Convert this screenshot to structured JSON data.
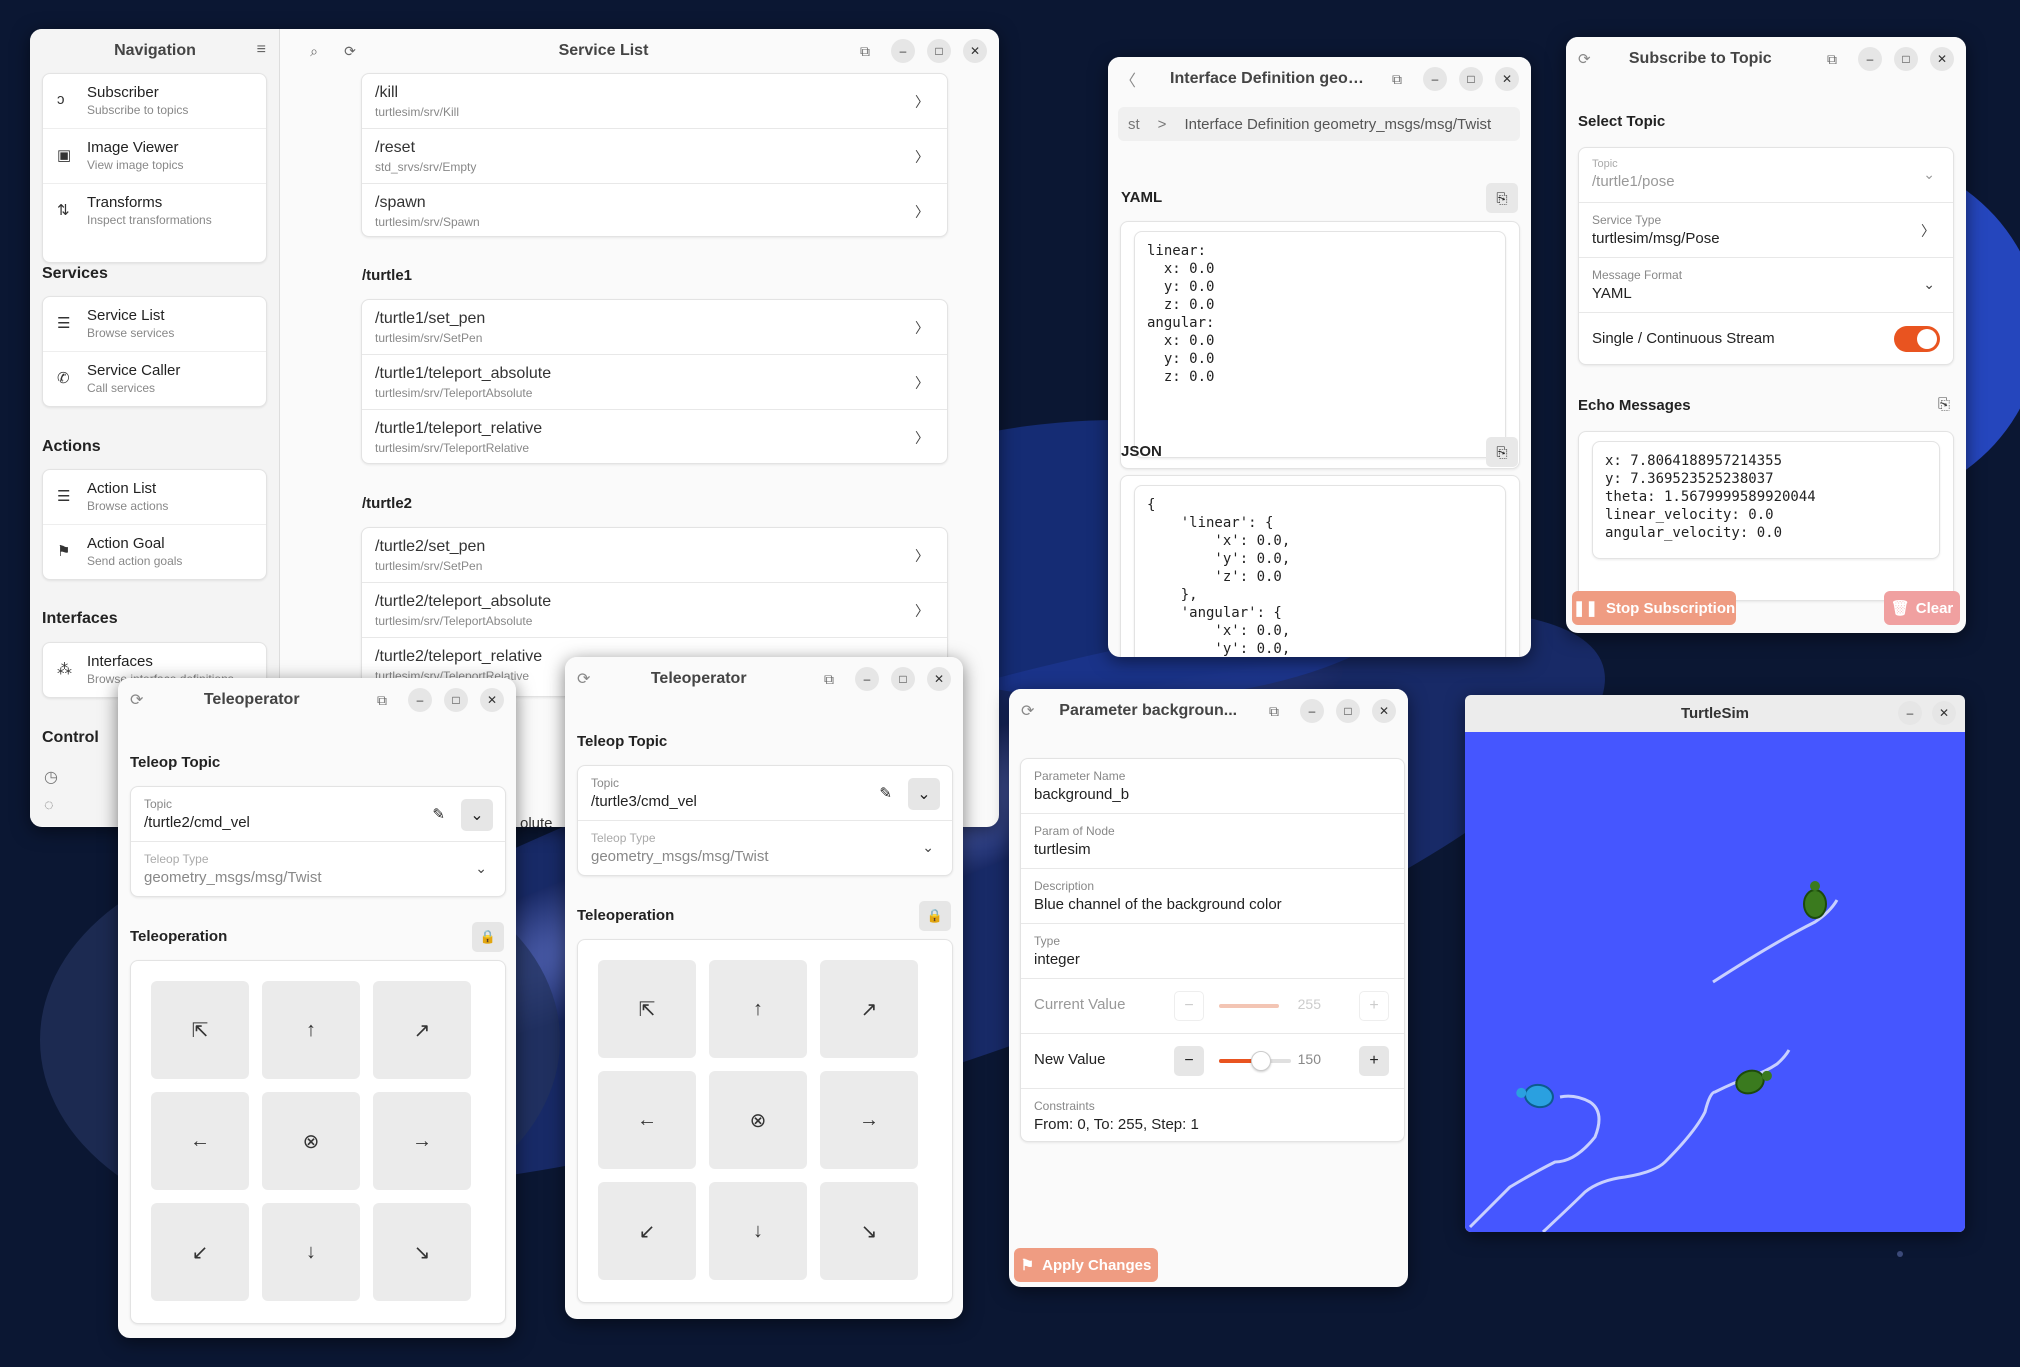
{
  "colors": {
    "accent": "#e95420",
    "desktop": "#0b1733",
    "turtle_bg": "#4556ff"
  },
  "nav": {
    "title": "Navigation",
    "group0": [
      {
        "name": "Subscriber",
        "desc": "Subscribe to topics",
        "icon": "ear-icon"
      },
      {
        "name": "Image Viewer",
        "desc": "View image topics",
        "icon": "image-icon"
      },
      {
        "name": "Transforms",
        "desc": "Inspect transformations",
        "icon": "transform-icon"
      }
    ],
    "services_heading": "Services",
    "services": [
      {
        "name": "Service List",
        "desc": "Browse services",
        "icon": "list-icon"
      },
      {
        "name": "Service Caller",
        "desc": "Call services",
        "icon": "phone-icon"
      }
    ],
    "actions_heading": "Actions",
    "actions": [
      {
        "name": "Action List",
        "desc": "Browse actions",
        "icon": "list-icon"
      },
      {
        "name": "Action Goal",
        "desc": "Send action goals",
        "icon": "flag-icon"
      }
    ],
    "interfaces_heading": "Interfaces",
    "interfaces": [
      {
        "name": "Interfaces",
        "desc": "Browse interface definitions",
        "icon": "shapes-icon"
      }
    ],
    "control_heading": "Control"
  },
  "service_list": {
    "title": "Service List",
    "group0": [
      {
        "name": "/kill",
        "type": "turtlesim/srv/Kill"
      },
      {
        "name": "/reset",
        "type": "std_srvs/srv/Empty"
      },
      {
        "name": "/spawn",
        "type": "turtlesim/srv/Spawn"
      }
    ],
    "turtle1_heading": "/turtle1",
    "turtle1": [
      {
        "name": "/turtle1/set_pen",
        "type": "turtlesim/srv/SetPen"
      },
      {
        "name": "/turtle1/teleport_absolute",
        "type": "turtlesim/srv/TeleportAbsolute"
      },
      {
        "name": "/turtle1/teleport_relative",
        "type": "turtlesim/srv/TeleportRelative"
      }
    ],
    "turtle2_heading": "/turtle2",
    "turtle2": [
      {
        "name": "/turtle2/set_pen",
        "type": "turtlesim/srv/SetPen"
      },
      {
        "name": "/turtle2/teleport_absolute",
        "type": "turtlesim/srv/TeleportAbsolute"
      },
      {
        "name": "/turtle2/teleport_relative",
        "type": "turtlesim/srv/TeleportRelative"
      }
    ],
    "partial_text": "olute"
  },
  "interface_def": {
    "title": "Interface Definition geom...",
    "crumb_prev": "st",
    "crumb_sep": ">",
    "crumb_current": "Interface Definition geometry_msgs/msg/Twist",
    "yaml_heading": "YAML",
    "yaml": "linear:\n  x: 0.0\n  y: 0.0\n  z: 0.0\nangular:\n  x: 0.0\n  y: 0.0\n  z: 0.0",
    "json_heading": "JSON",
    "json": "{\n    'linear': {\n        'x': 0.0,\n        'y': 0.0,\n        'z': 0.0\n    },\n    'angular': {\n        'x': 0.0,\n        'y': 0.0,"
  },
  "subscribe": {
    "title": "Subscribe to Topic",
    "select_heading": "Select Topic",
    "topic_label": "Topic",
    "topic_value": "/turtle1/pose",
    "service_type_label": "Service Type",
    "service_type_value": "turtlesim/msg/Pose",
    "format_label": "Message Format",
    "format_value": "YAML",
    "stream_label": "Single / Continuous Stream",
    "stream_on": true,
    "echo_heading": "Echo Messages",
    "echo": "x: 7.8064188957214355\ny: 7.369523525238037\ntheta: 1.5679999589920044\nlinear_velocity: 0.0\nangular_velocity: 0.0",
    "stop_label": "Stop Subscription",
    "clear_label": "Clear"
  },
  "teleop_a": {
    "title": "Teleoperator",
    "topic_heading": "Teleop Topic",
    "topic_label": "Topic",
    "topic_value": "/turtle2/cmd_vel",
    "type_label": "Teleop Type",
    "type_value": "geometry_msgs/msg/Twist",
    "op_heading": "Teleoperation"
  },
  "teleop_b": {
    "title": "Teleoperator",
    "topic_heading": "Teleop Topic",
    "topic_label": "Topic",
    "topic_value": "/turtle3/cmd_vel",
    "type_label": "Teleop Type",
    "type_value": "geometry_msgs/msg/Twist",
    "op_heading": "Teleoperation"
  },
  "pad_glyphs": [
    "⇱",
    "↑",
    "↗",
    "←",
    "⊗",
    "→",
    "↙",
    "↓",
    "↘"
  ],
  "param": {
    "title": "Parameter backgroun...",
    "name_label": "Parameter Name",
    "name_value": "background_b",
    "node_label": "Param of Node",
    "node_value": "turtlesim",
    "desc_label": "Description",
    "desc_value": "Blue channel of the background color",
    "type_label": "Type",
    "type_value": "integer",
    "current_label": "Current Value",
    "current_value": "255",
    "current_fraction": 1.0,
    "new_label": "New Value",
    "new_value": "150",
    "new_fraction": 0.588,
    "constraints_label": "Constraints",
    "constraints_value": "From: 0, To: 255, Step: 1",
    "apply_label": "Apply Changes"
  },
  "turtlesim": {
    "title": "TurtleSim"
  }
}
